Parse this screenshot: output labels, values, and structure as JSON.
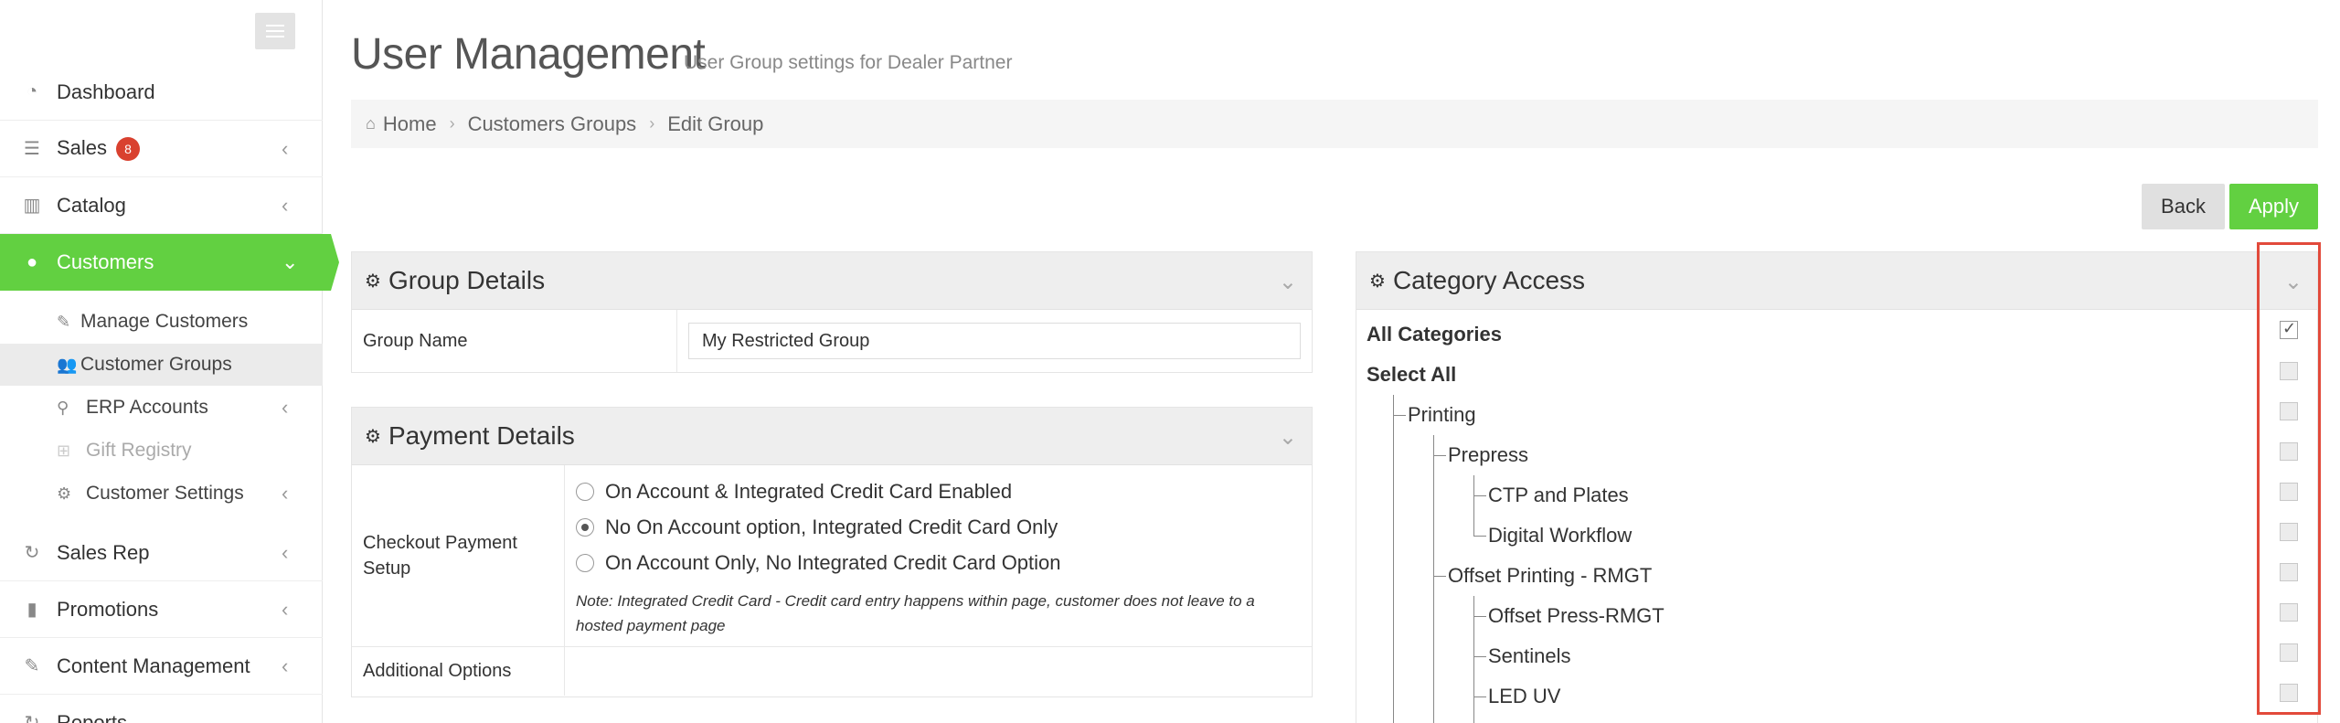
{
  "sidebar": {
    "items": [
      {
        "label": "Dashboard",
        "icon": "dashboard-icon"
      },
      {
        "label": "Sales",
        "icon": "sales-icon",
        "badge": "8"
      },
      {
        "label": "Catalog",
        "icon": "catalog-icon"
      },
      {
        "label": "Customers",
        "icon": "user-icon"
      },
      {
        "label": "Sales Rep",
        "icon": "refresh-icon"
      },
      {
        "label": "Promotions",
        "icon": "bar-chart-icon"
      },
      {
        "label": "Content Management",
        "icon": "edit-icon"
      },
      {
        "label": "Reports",
        "icon": "refresh-icon"
      }
    ],
    "customers_sub": [
      {
        "label": "Manage Customers",
        "icon": "edit-icon"
      },
      {
        "label": "Customer Groups",
        "icon": "users-icon"
      },
      {
        "label": "ERP Accounts",
        "icon": "sitemap-icon"
      },
      {
        "label": "Gift Registry",
        "icon": "gift-icon"
      },
      {
        "label": "Customer Settings",
        "icon": "gear-icon"
      }
    ]
  },
  "header": {
    "title": "User Management",
    "subtitle": "User Group settings for Dealer Partner"
  },
  "breadcrumb": [
    "Home",
    "Customers Groups",
    "Edit Group"
  ],
  "actions": {
    "back": "Back",
    "apply": "Apply"
  },
  "group_details": {
    "title": "Group Details",
    "name_label": "Group Name",
    "name_value": "My Restricted Group"
  },
  "payment_details": {
    "title": "Payment Details",
    "checkout_label": "Checkout Payment Setup",
    "options": [
      "On Account & Integrated Credit Card Enabled",
      "No On Account option, Integrated Credit Card Only",
      "On Account Only, No Integrated Credit Card Option"
    ],
    "selected_index": 1,
    "note": "Note: Integrated Credit Card - Credit card entry happens within page, customer does not leave to a hosted payment page",
    "additional_label": "Additional Options"
  },
  "category_access": {
    "title": "Category Access",
    "all_categories": "All Categories",
    "select_all": "Select All",
    "tree": [
      {
        "label": "Printing",
        "level": 1
      },
      {
        "label": "Prepress",
        "level": 2
      },
      {
        "label": "CTP and Plates",
        "level": 3
      },
      {
        "label": "Digital Workflow",
        "level": 3
      },
      {
        "label": "Offset Printing - RMGT",
        "level": 2
      },
      {
        "label": "Offset Press-RMGT",
        "level": 3
      },
      {
        "label": "Sentinels",
        "level": 3
      },
      {
        "label": "LED UV",
        "level": 3
      }
    ],
    "all_categories_checked": true
  },
  "colors": {
    "accent": "#62d041",
    "badge": "#d9412f",
    "highlight": "#e24a3b"
  }
}
